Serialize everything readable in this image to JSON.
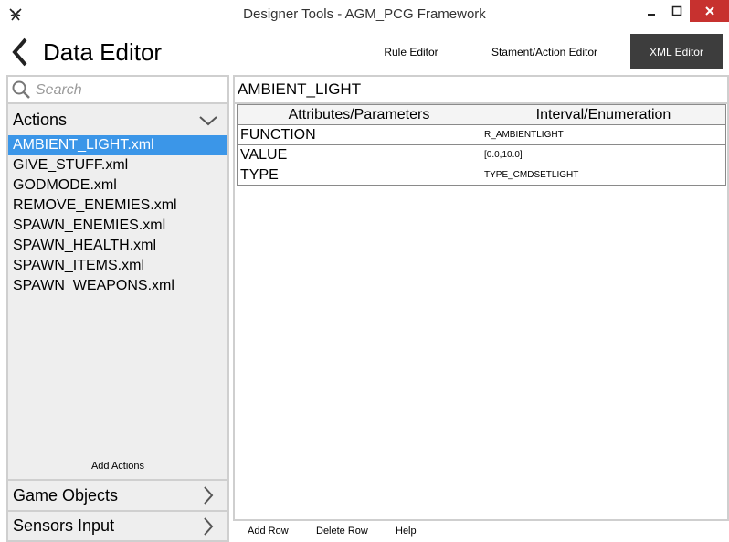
{
  "window": {
    "title": "Designer Tools - AGM_PCG Framework",
    "close_color": "#c7312f"
  },
  "header": {
    "title": "Data Editor",
    "nav": {
      "rule_editor": "Rule Editor",
      "stament_action_editor": "Stament/Action Editor",
      "xml_editor": "XML Editor"
    },
    "active_nav": "xml_editor"
  },
  "sidebar": {
    "search": {
      "placeholder": "Search",
      "value": ""
    },
    "actions": {
      "label": "Actions",
      "expanded": true,
      "items": [
        {
          "label": "AMBIENT_LIGHT.xml",
          "selected": true
        },
        {
          "label": "GIVE_STUFF.xml",
          "selected": false
        },
        {
          "label": "GODMODE.xml",
          "selected": false
        },
        {
          "label": "REMOVE_ENEMIES.xml",
          "selected": false
        },
        {
          "label": "SPAWN_ENEMIES.xml",
          "selected": false
        },
        {
          "label": "SPAWN_HEALTH.xml",
          "selected": false
        },
        {
          "label": "SPAWN_ITEMS.xml",
          "selected": false
        },
        {
          "label": "SPAWN_WEAPONS.xml",
          "selected": false
        }
      ],
      "add_label": "Add Actions"
    },
    "game_objects": {
      "label": "Game Objects"
    },
    "sensors_input": {
      "label": "Sensors Input"
    },
    "selected_color": "#3b96e8"
  },
  "main": {
    "action_name": "AMBIENT_LIGHT",
    "table": {
      "headers": [
        "Attributes/Parameters",
        "Interval/Enumeration"
      ],
      "rows": [
        {
          "name": "FUNCTION",
          "value": "R_AMBIENTLIGHT"
        },
        {
          "name": "VALUE",
          "value": "[0.0,10.0]"
        },
        {
          "name": "TYPE",
          "value": "TYPE_CMDSETLIGHT"
        }
      ]
    },
    "buttons": {
      "add_row": "Add Row",
      "delete_row": "Delete Row",
      "help": "Help"
    }
  }
}
